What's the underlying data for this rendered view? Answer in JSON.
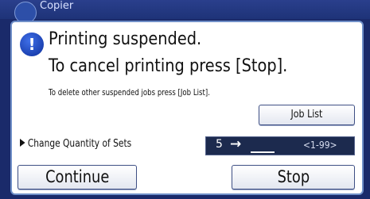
{
  "window": {
    "title": "Copier"
  },
  "dialog": {
    "title_line1": "Printing suspended.",
    "title_line2": "To cancel printing press [Stop].",
    "subtitle": "To delete other suspended jobs press [Job List].",
    "job_list_label": "Job List",
    "quantity_label": "Change Quantity of Sets",
    "quantity_current": "5",
    "quantity_arrow": "→",
    "quantity_input_value": "",
    "quantity_range": "<1-99>",
    "continue_label": "Continue",
    "stop_label": "Stop"
  },
  "icons": {
    "app": "copier-icon",
    "warning": "exclamation-icon"
  },
  "colors": {
    "accent": "#1a2a6a",
    "warning_icon": "#1f4fd0",
    "quantity_panel": "#1c2a4e"
  }
}
